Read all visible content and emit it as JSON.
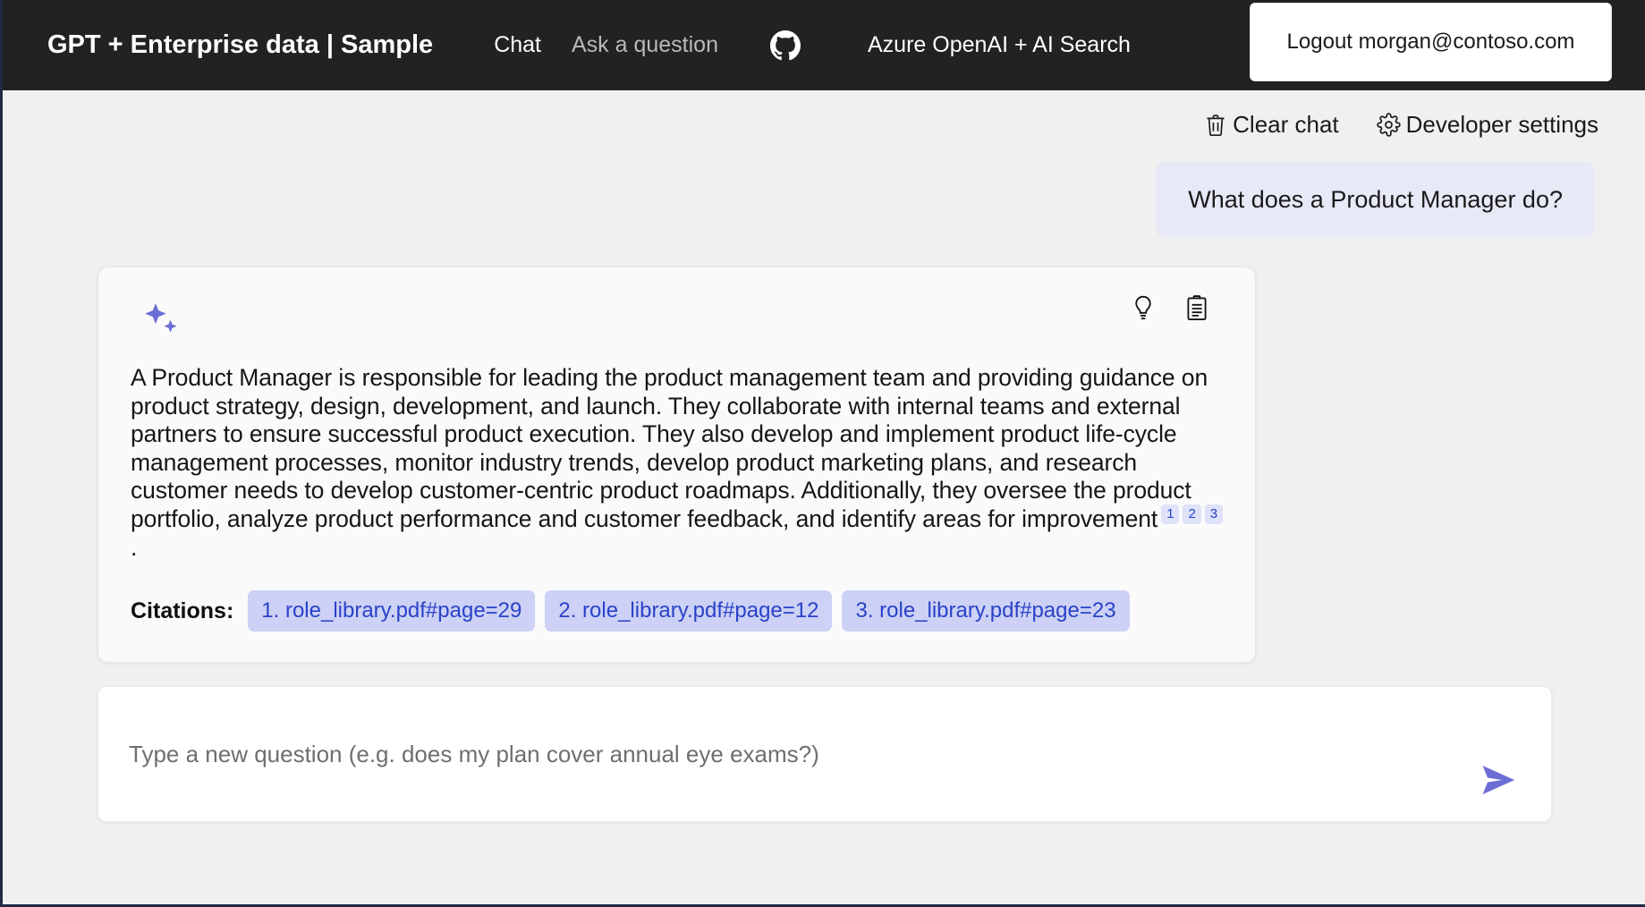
{
  "header": {
    "brand": "GPT + Enterprise data | Sample",
    "nav": [
      {
        "label": "Chat",
        "active": true
      },
      {
        "label": "Ask a question",
        "active": false
      }
    ],
    "github_icon": "github-icon",
    "subtitle": "Azure OpenAI + AI Search",
    "logout_label": "Logout morgan@contoso.com"
  },
  "command_bar": {
    "clear_chat": "Clear chat",
    "clear_chat_icon": "trash-icon",
    "developer_settings": "Developer settings",
    "developer_settings_icon": "gear-icon"
  },
  "conversation": {
    "user_message": "What does a Product Manager do?",
    "answer": {
      "avatar_icon": "sparkle-icon",
      "actions": [
        {
          "icon": "lightbulb-icon",
          "name": "show-thought-process"
        },
        {
          "icon": "clipboard-icon",
          "name": "show-supporting-content"
        }
      ],
      "text": "A Product Manager is responsible for leading the product management team and providing guidance on product strategy, design, development, and launch. They collaborate with internal teams and external partners to ensure successful product execution. They also develop and implement product life-cycle management processes, monitor industry trends, develop product marketing plans, and research customer needs to develop customer-centric product roadmaps. Additionally, they oversee the product portfolio, analyze product performance and customer feedback, and identify areas for improvement",
      "inline_citations": [
        "1",
        "2",
        "3"
      ],
      "trailing_punctuation": ".",
      "citations_label": "Citations:",
      "citations": [
        "1. role_library.pdf#page=29",
        "2. role_library.pdf#page=12",
        "3. role_library.pdf#page=23"
      ]
    }
  },
  "input": {
    "placeholder": "Type a new question (e.g. does my plan cover annual eye exams?)",
    "value": "",
    "send_icon": "send-icon"
  },
  "colors": {
    "header_bg": "#222222",
    "page_bg": "#f0f0f0",
    "accent": "#6b6fd4",
    "user_bubble": "#e7e9f7",
    "citation_chip": "#ccd1f5",
    "citation_text": "#2a42c8"
  }
}
